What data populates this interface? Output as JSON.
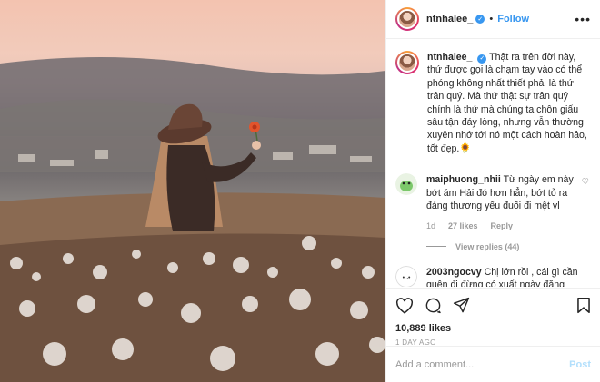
{
  "post": {
    "username": "ntnhalee_",
    "follow_label": "Follow",
    "more_icon": "more-horizontal-icon",
    "separator": "•",
    "caption": "Thật ra trên đời này, thứ được gọi là chạm tay vào có thể phóng không nhất thiết phải là thứ trân quý. Mà thứ thật sự trân quý chính là thứ mà chúng ta chôn giấu sâu tận đáy lòng, nhưng vẫn thường xuyên nhớ tới nó một cách hoàn hảo, tốt đẹp.🌻"
  },
  "comments": [
    {
      "username": "maiphuong_nhii",
      "text": "Từ ngày em này bớt ám Hải đó hơn hẳn, bớt tỏ ra đáng thương yếu đuối đi mệt vl",
      "time": "1d",
      "likes": "27 likes",
      "reply_label": "Reply",
      "view_replies": "View replies (44)"
    },
    {
      "username": "2003ngocvy",
      "text": "Chị lớn rồi , cái gì cần quên đi đừng có xuất ngày đăng tâm trạng có đc gì đâu"
    }
  ],
  "footer": {
    "likes": "10,889 likes",
    "time_ago": "1 DAY AGO",
    "comment_placeholder": "Add a comment...",
    "post_label": "Post"
  },
  "colors": {
    "accent": "#3897f0",
    "post_disabled": "#b2dffc",
    "muted": "#999999"
  }
}
